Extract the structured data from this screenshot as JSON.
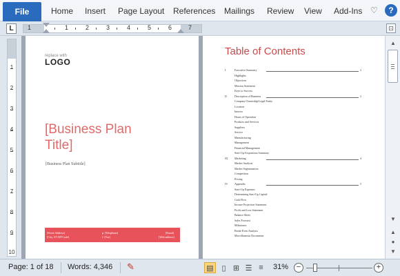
{
  "ribbon": {
    "file_label": "File",
    "tabs": [
      "Home",
      "Insert",
      "Page Layout",
      "References",
      "Mailings",
      "Review",
      "View",
      "Add-Ins"
    ],
    "help_label": "?"
  },
  "ruler": {
    "tab_selector": "L",
    "h_numbers": [
      "1",
      "1",
      "2",
      "3",
      "4",
      "5",
      "6",
      "7"
    ],
    "v_numbers": [
      "1",
      "2",
      "3",
      "4",
      "5",
      "6",
      "7",
      "8",
      "9",
      "10"
    ]
  },
  "page1": {
    "logo_small": "replace with",
    "logo": "LOGO",
    "title_line1": "[Business Plan",
    "title_line2": "Title]",
    "subtitle": "[Business Plan Subtitle]",
    "footer": {
      "address_line1": "[Street Address]",
      "address_line2": "[City, ST ZIP Code]",
      "phone_line1": "p. [Telephone]",
      "phone_line2": "f. [Fax]",
      "email_line1": "[Email]",
      "email_line2": "[Web address]"
    }
  },
  "page2": {
    "toc_title": "Table of Contents",
    "sections": [
      {
        "num": "I.",
        "title": "Executive Summary",
        "page": "2",
        "items": [
          "Highlights",
          "Objectives",
          "Mission Statement",
          "Keys to Success"
        ]
      },
      {
        "num": "II.",
        "title": "Description of Business",
        "page": "2",
        "items": [
          "Company Ownership/Legal Entity",
          "Location",
          "Interior",
          "Hours of Operation",
          "Products and Services",
          "Suppliers",
          "Service",
          "Manufacturing",
          "Management",
          "Financial Management",
          "Start-Up/Acquisition Summary"
        ]
      },
      {
        "num": "III.",
        "title": "Marketing",
        "page": "4",
        "items": [
          "Market Analysis",
          "Market Segmentation",
          "Competition",
          "Pricing"
        ]
      },
      {
        "num": "IV.",
        "title": "Appendix",
        "page": "5",
        "items": [
          "Start-Up Expenses",
          "Determining Start-Up Capital",
          "Cash Flow",
          "Income Projection Statement",
          "Profit and Loss Statement",
          "Balance Sheet",
          "Sales Forecast",
          "Milestones",
          "Break-Even Analysis",
          "Miscellaneous Documents"
        ]
      }
    ]
  },
  "status": {
    "page": "Page: 1 of 18",
    "words": "Words: 4,346",
    "zoom": "31%",
    "zoom_minus": "−",
    "zoom_plus": "+"
  },
  "colors": {
    "file_tab": "#2a6bbd",
    "title_red": "#e06a6a",
    "footer_band": "#e8525a",
    "workspace": "#9da6b1"
  }
}
